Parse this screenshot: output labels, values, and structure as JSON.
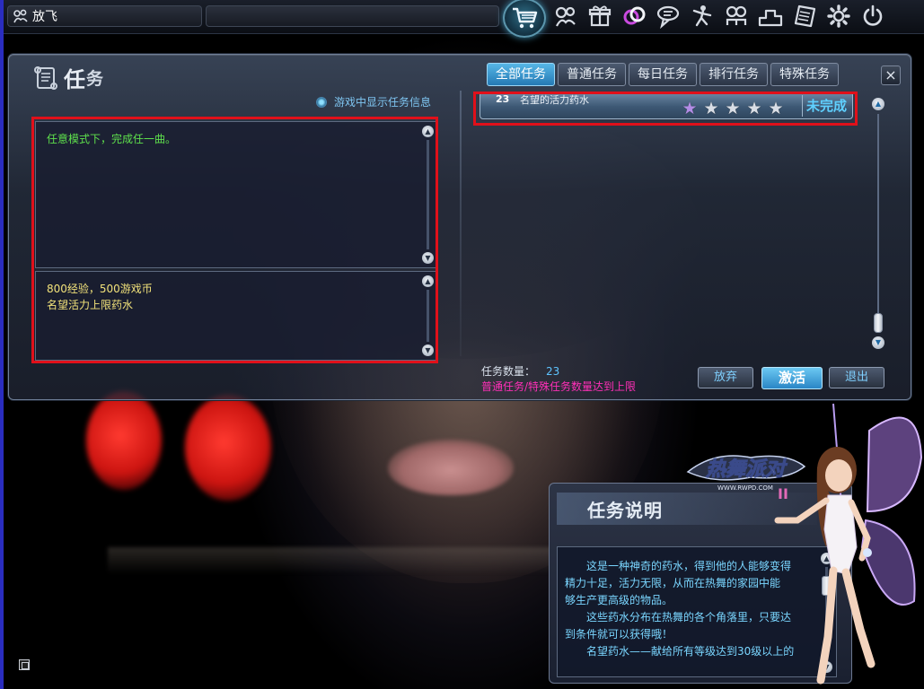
{
  "topbar": {
    "player_name": "放飞",
    "icons": [
      "shop-cart-icon",
      "pets-icon",
      "gift-box-icon",
      "couple-ring-icon",
      "chat-icon",
      "dance-icon",
      "friends-icon",
      "ranking-icon",
      "notes-icon",
      "settings-gear-icon",
      "power-icon"
    ]
  },
  "task_window": {
    "title_main": "任",
    "title_sub": "务",
    "tabs": [
      {
        "label": "全部任务",
        "active": true
      },
      {
        "label": "普通任务",
        "active": false
      },
      {
        "label": "每日任务",
        "active": false
      },
      {
        "label": "排行任务",
        "active": false
      },
      {
        "label": "特殊任务",
        "active": false
      }
    ],
    "close_label": "×",
    "show_info_label": "游戏中显示任务信息",
    "description": "任意模式下，完成任一曲。",
    "rewards": [
      "800经验，500游戏币",
      "名望活力上限药水"
    ],
    "task_list": [
      {
        "number": "23",
        "name": "名望的活力药水",
        "stars_filled": 1,
        "stars_total": 5,
        "status": "未完成"
      }
    ],
    "count_label": "任务数量：",
    "count_value": "23",
    "limit_message": "普通任务/特殊任务数量达到上限",
    "buttons": {
      "abandon": "放弃",
      "activate": "激活",
      "exit": "退出"
    }
  },
  "desc_popup": {
    "title": "任务说明",
    "lines": [
      "这是一种神奇的药水，得到他的人能够变得",
      "精力十足，活力无限，从而在热舞的家园中能",
      "够生产更高级的物品。",
      "这些药水分布在热舞的各个角落里，只要达",
      "到条件就可以获得哦！",
      "名望药水——献给所有等级达到30级以上的"
    ]
  },
  "logo_text": "热舞派对",
  "logo_url_text": "WWW.RWPD.COM",
  "colors": {
    "accent_blue": "#5ec4ff",
    "task_desc_green": "#5ee04c",
    "reward_yellow": "#f2e27a",
    "limit_pink": "#ff2fb8",
    "highlight_red": "#e0101a"
  }
}
